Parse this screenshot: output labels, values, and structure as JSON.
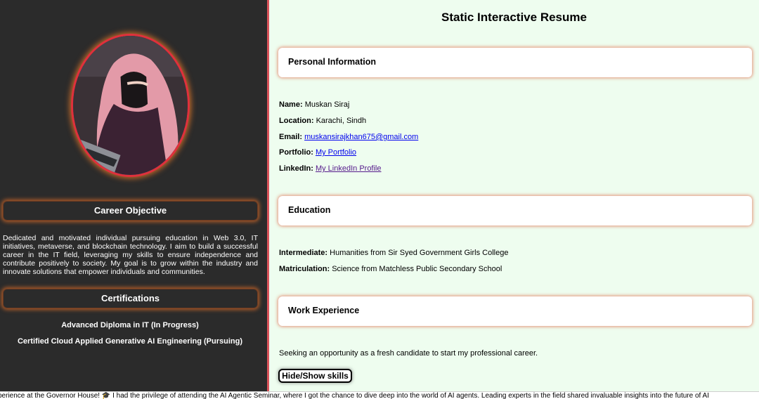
{
  "sidebar": {
    "career_objective_heading": "Career Objective",
    "career_objective_text": "Dedicated and motivated individual pursuing education in Web 3.0, IT initiatives, metaverse, and blockchain technology. I aim to build a successful career in the IT field, leveraging my skills to ensure independence and contribute positively to society. My goal is to grow within the industry and innovate solutions that empower individuals and communities.",
    "certifications_heading": "Certifications",
    "certifications": [
      "Advanced Diploma in IT (In Progress)",
      "Certified Cloud Applied Generative AI Engineering (Pursuing)"
    ]
  },
  "main": {
    "title": "Static Interactive Resume",
    "personal": {
      "heading": "Personal Information",
      "name_label": "Name:",
      "name": "Muskan Siraj",
      "location_label": "Location:",
      "location": "Karachi, Sindh",
      "email_label": "Email:",
      "email": "muskansirajkhan675@gmail.com",
      "portfolio_label": "Portfolio:",
      "portfolio": "My Portfolio",
      "linkedin_label": "LinkedIn:",
      "linkedin": "My LinkedIn Profile"
    },
    "education": {
      "heading": "Education",
      "intermediate_label": "Intermediate:",
      "intermediate": "Humanities from Sir Syed Government Girls College",
      "matric_label": "Matriculation:",
      "matric": "Science from Matchless Public Secondary School"
    },
    "work": {
      "heading": "Work Experience",
      "text": "Seeking an opportunity as a fresh candidate to start my professional career."
    },
    "toggle_button": "Hide/Show skills"
  },
  "ticker": {
    "text": "perience at the Governor House! 🎓 I had the privilege of attending the AI Agentic Seminar, where I got the chance to dive deep into the world of AI agents. Leading experts in the field shared invaluable insights into the future of AI"
  },
  "colors": {
    "sidebar_bg": "#2b2b2b",
    "main_bg": "#eefdef",
    "accent_glow": "#e06a2a",
    "divider": "#d9535a"
  }
}
